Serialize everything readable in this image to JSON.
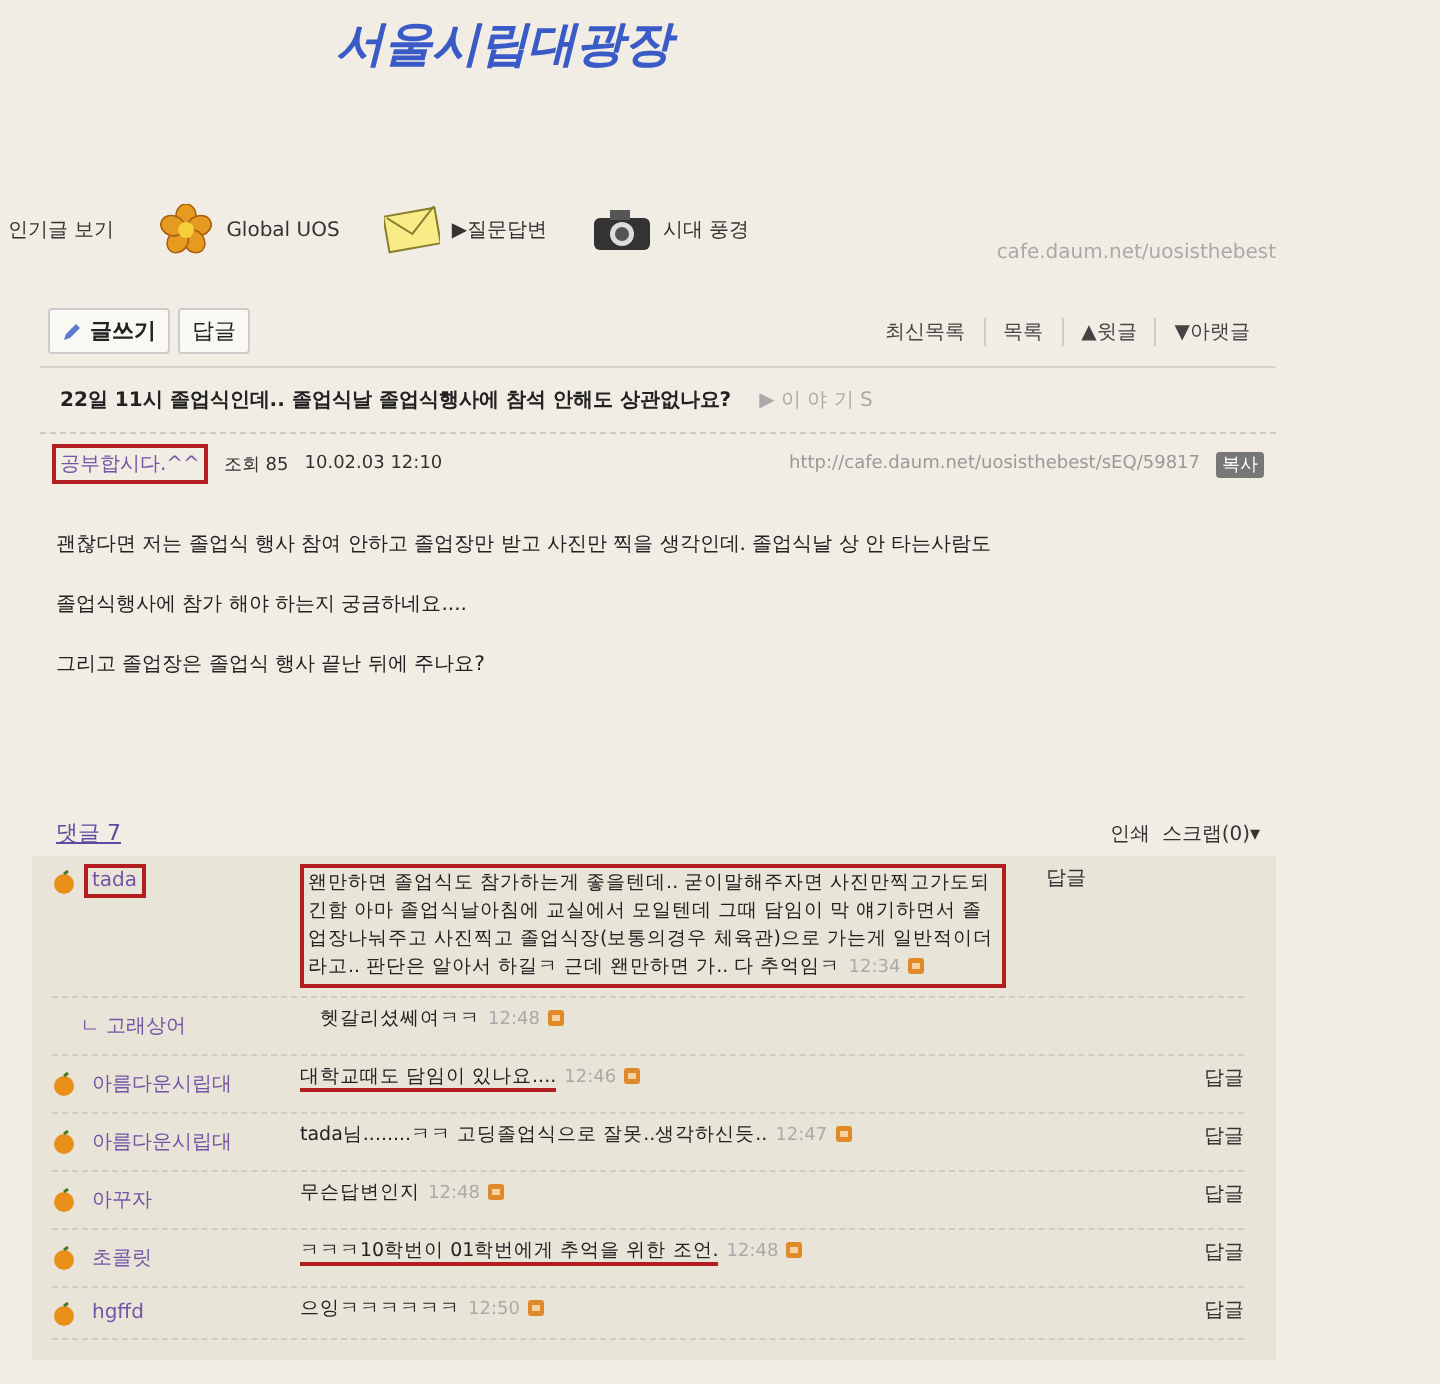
{
  "cafe_title": "서울시립대광장",
  "nav": [
    {
      "label": "인기글 보기",
      "kind": "none"
    },
    {
      "label": "Global UOS",
      "kind": "flower"
    },
    {
      "label": "▶질문답변",
      "kind": "envelope"
    },
    {
      "label": "시대 풍경",
      "kind": "camera"
    }
  ],
  "cafe_url": "cafe.daum.net/uosisthebest",
  "toolbar": {
    "write": "글쓰기",
    "reply": "답글",
    "links": [
      "최신목록",
      "목록",
      "▲윗글",
      "▼아랫글"
    ]
  },
  "post": {
    "title": "22일 11시 졸업식인데.. 졸업식날 졸업식행사에 참석 안해도 상관없나요?",
    "board": "▶ 이 야 기 S",
    "author": "공부합시다.^^",
    "author_marked": true,
    "views": "조회 85",
    "date": "10.02.03 12:10",
    "url": "http://cafe.daum.net/uosisthebest/sEQ/59817",
    "copy": "복사",
    "paragraphs": [
      "괜찮다면 저는 졸업식 행사 참여 안하고 졸업장만 받고 사진만 찍을 생각인데. 졸업식날 상 안 타는사람도",
      "졸업식행사에 참가 해야 하는지 궁금하네요....",
      "그리고 졸업장은 졸업식 행사 끝난 뒤에 주나요?"
    ]
  },
  "comments_header": {
    "label": "댓글 7",
    "print": "인쇄",
    "scrap": "스크랩(0)▾"
  },
  "comments": [
    {
      "author": "tada",
      "author_marked": true,
      "text": "왠만하면 졸업식도 참가하는게 좋을텐데.. 굳이말해주자면 사진만찍고가도되긴함 아마 졸업식날아침에 교실에서 모일텐데 그때 담임이 막 얘기하면서 졸업장나눠주고 사진찍고 졸업식장(보통의경우 체육관)으로 가는게 일반적이더라고.. 판단은 알아서 하길ㅋ 근데 왠만하면 가.. 다 추억임ㅋ",
      "time": "12:34",
      "boxed": true,
      "underlined": false,
      "reply": "답글",
      "children": [
        {
          "author": "ㄴ 고래상어",
          "text": "헷갈리셨쎄여ㅋㅋ",
          "time": "12:48"
        }
      ]
    },
    {
      "author": "아름다운시립대",
      "author_marked": false,
      "text": "대학교때도 담임이 있나요....",
      "time": "12:46",
      "boxed": false,
      "underlined": true,
      "reply": "답글"
    },
    {
      "author": "아름다운시립대",
      "author_marked": false,
      "text": "tada님........ㅋㅋ 고딩졸업식으로 잘못..생각하신듯..",
      "time": "12:47",
      "boxed": false,
      "underlined": false,
      "reply": "답글"
    },
    {
      "author": "아꾸자",
      "author_marked": false,
      "text": "무슨답변인지",
      "time": "12:48",
      "boxed": false,
      "underlined": false,
      "reply": "답글"
    },
    {
      "author": "초콜릿",
      "author_marked": false,
      "text": "ㅋㅋㅋ10학번이 01학번에게 추억을 위한 조언.",
      "time": "12:48",
      "boxed": false,
      "underlined": true,
      "reply": "답글"
    },
    {
      "author": "hgffd",
      "author_marked": false,
      "text": "으잉ㅋㅋㅋㅋㅋㅋ",
      "time": "12:50",
      "boxed": false,
      "underlined": false,
      "reply": "답글"
    }
  ]
}
